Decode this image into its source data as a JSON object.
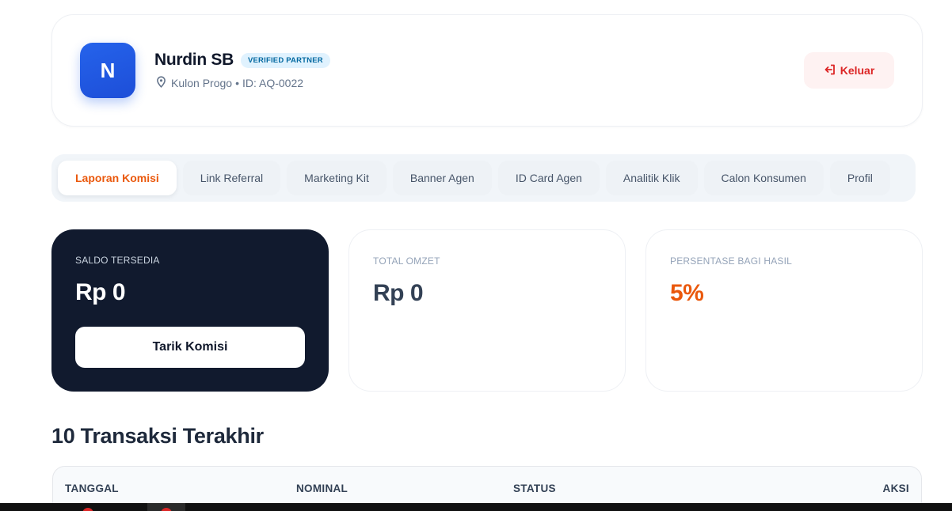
{
  "profile": {
    "avatar_initial": "N",
    "name": "Nurdin SB",
    "badge": "VERIFIED PARTNER",
    "location": "Kulon Progo",
    "separator": "•",
    "agent_id": "ID: AQ-0022",
    "logout_label": "Keluar"
  },
  "tabs": [
    {
      "label": "Laporan Komisi",
      "active": true
    },
    {
      "label": "Link Referral",
      "active": false
    },
    {
      "label": "Marketing Kit",
      "active": false
    },
    {
      "label": "Banner Agen",
      "active": false
    },
    {
      "label": "ID Card Agen",
      "active": false
    },
    {
      "label": "Analitik Klik",
      "active": false
    },
    {
      "label": "Calon Konsumen",
      "active": false
    },
    {
      "label": "Profil",
      "active": false
    }
  ],
  "stats": {
    "balance": {
      "label": "SALDO TERSEDIA",
      "value": "Rp 0",
      "button_label": "Tarik Komisi"
    },
    "omzet": {
      "label": "TOTAL OMZET",
      "value": "Rp 0"
    },
    "share": {
      "label": "PERSENTASE BAGI HASIL",
      "value": "5%"
    }
  },
  "transactions": {
    "title": "10 Transaksi Terakhir",
    "columns": [
      "TANGGAL",
      "NOMINAL",
      "STATUS",
      "AKSI"
    ]
  },
  "colors": {
    "accent": "#ea580c",
    "primary": "#2563eb",
    "dark_card": "#111a2e",
    "danger": "#dc2626"
  },
  "icons": {
    "location": "map-pin-icon",
    "logout": "logout-icon"
  }
}
